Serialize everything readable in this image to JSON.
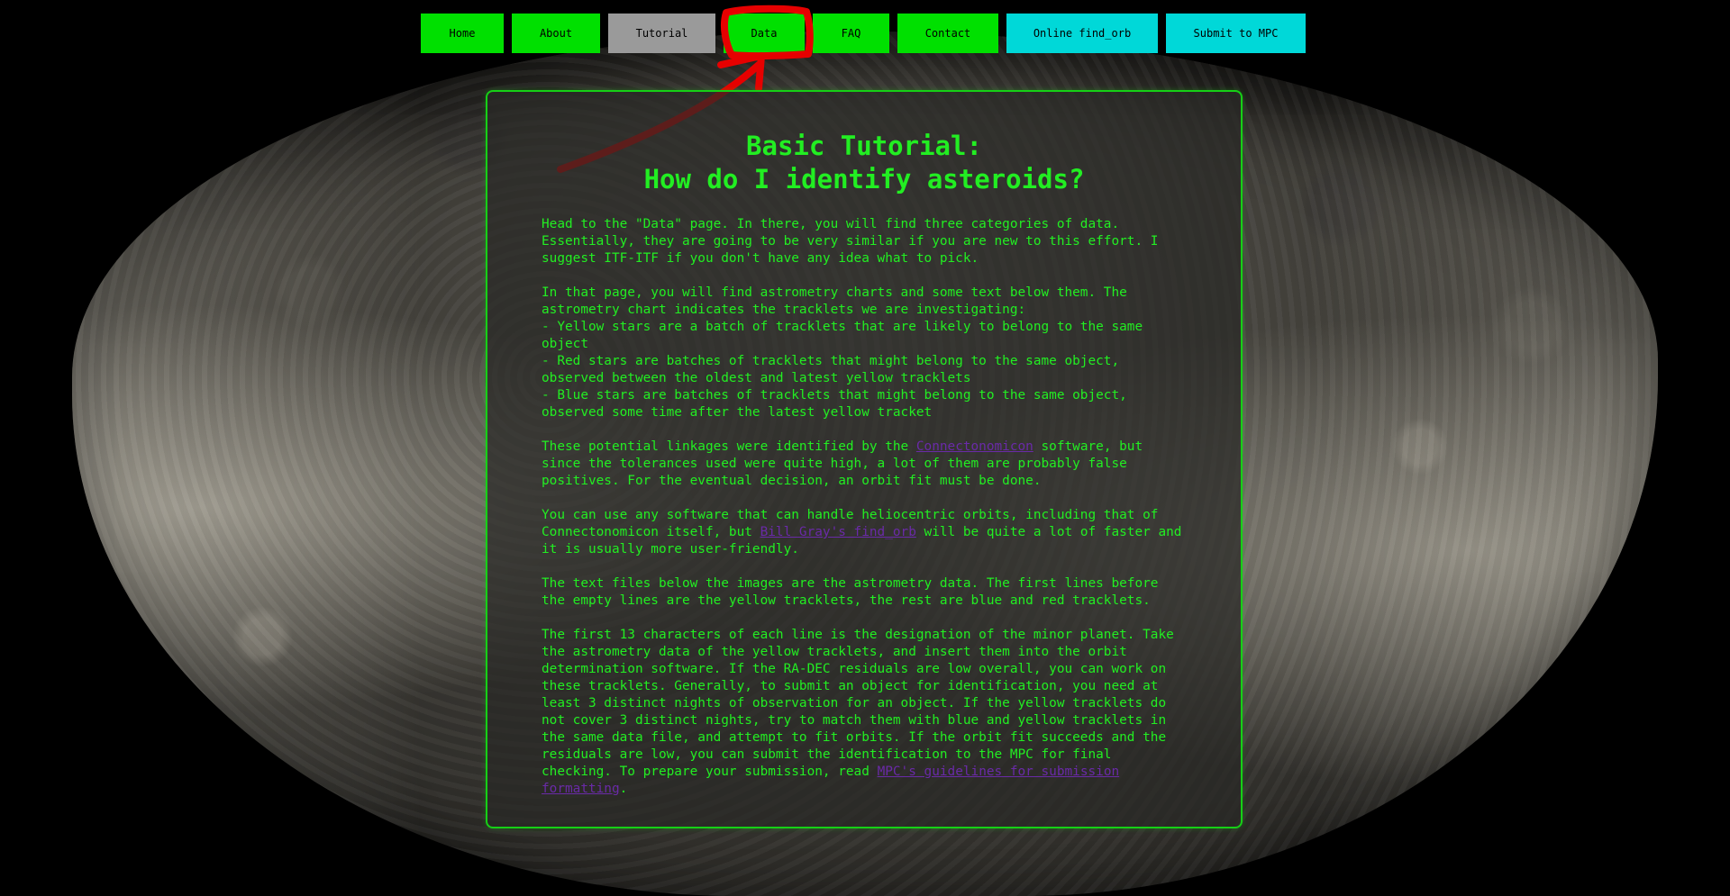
{
  "nav": {
    "home": "Home",
    "about": "About",
    "tutorial": "Tutorial",
    "data": "Data",
    "faq": "FAQ",
    "contact": "Contact",
    "online_find_orb": "Online find_orb",
    "submit_mpc": "Submit to MPC"
  },
  "colors": {
    "nav_green": "#00e000",
    "nav_active_gray": "#9a9a9a",
    "nav_cyan": "#00d8d8",
    "text_green": "#22ee22",
    "link_purple": "#6a2aa8",
    "annotation_red": "#e60000"
  },
  "tutorial": {
    "title_line1": "Basic Tutorial:",
    "title_line2": "How do I identify asteroids?",
    "p1": "Head to the \"Data\" page. In there, you will find three categories of data. Essentially, they are going to be very similar if you are new to this effort. I suggest ITF-ITF if you don't have any idea what to pick.",
    "p2_intro": "In that page, you will find astrometry charts and some text below them. The astrometry chart indicates the tracklets we are investigating:",
    "p2_yellow": "- Yellow stars are a batch of tracklets that are likely to belong to the same object",
    "p2_red": "- Red stars are batches of tracklets that might belong to the same object, observed between the oldest and latest yellow tracklets",
    "p2_blue": "- Blue stars are batches of tracklets that might belong to the same object, observed some time after the latest yellow tracket",
    "p3_before": "These potential linkages were identified by the ",
    "p3_link": "Connectonomicon",
    "p3_after": " software, but since the tolerances used were quite high, a lot of them are probably false positives. For the eventual decision, an orbit fit must be done.",
    "p4_before": "You can use any software that can handle heliocentric orbits, including that of Connectonomicon itself, but ",
    "p4_link": "Bill Gray's find_orb",
    "p4_after": " will be quite a lot of faster and it is usually more user-friendly.",
    "p5": "The text files below the images are the astrometry data. The first lines before the empty lines are the yellow tracklets, the rest are blue and red tracklets.",
    "p6_before": "The first 13 characters of each line is the designation of the minor planet. Take the astrometry data of the yellow tracklets, and insert them into the orbit determination software. If the RA-DEC residuals are low overall, you can work on these tracklets. Generally, to submit an object for identification, you need at least 3 distinct nights of observation for an object. If the yellow tracklets do not cover 3 distinct nights, try to match them with blue and yellow tracklets in the same data file, and attempt to fit orbits. If the orbit fit succeeds and the residuals are low, you can submit the identification to the MPC for final checking. To prepare your submission, read ",
    "p6_link": "MPC's guidelines for submission formatting",
    "p6_after": "."
  }
}
